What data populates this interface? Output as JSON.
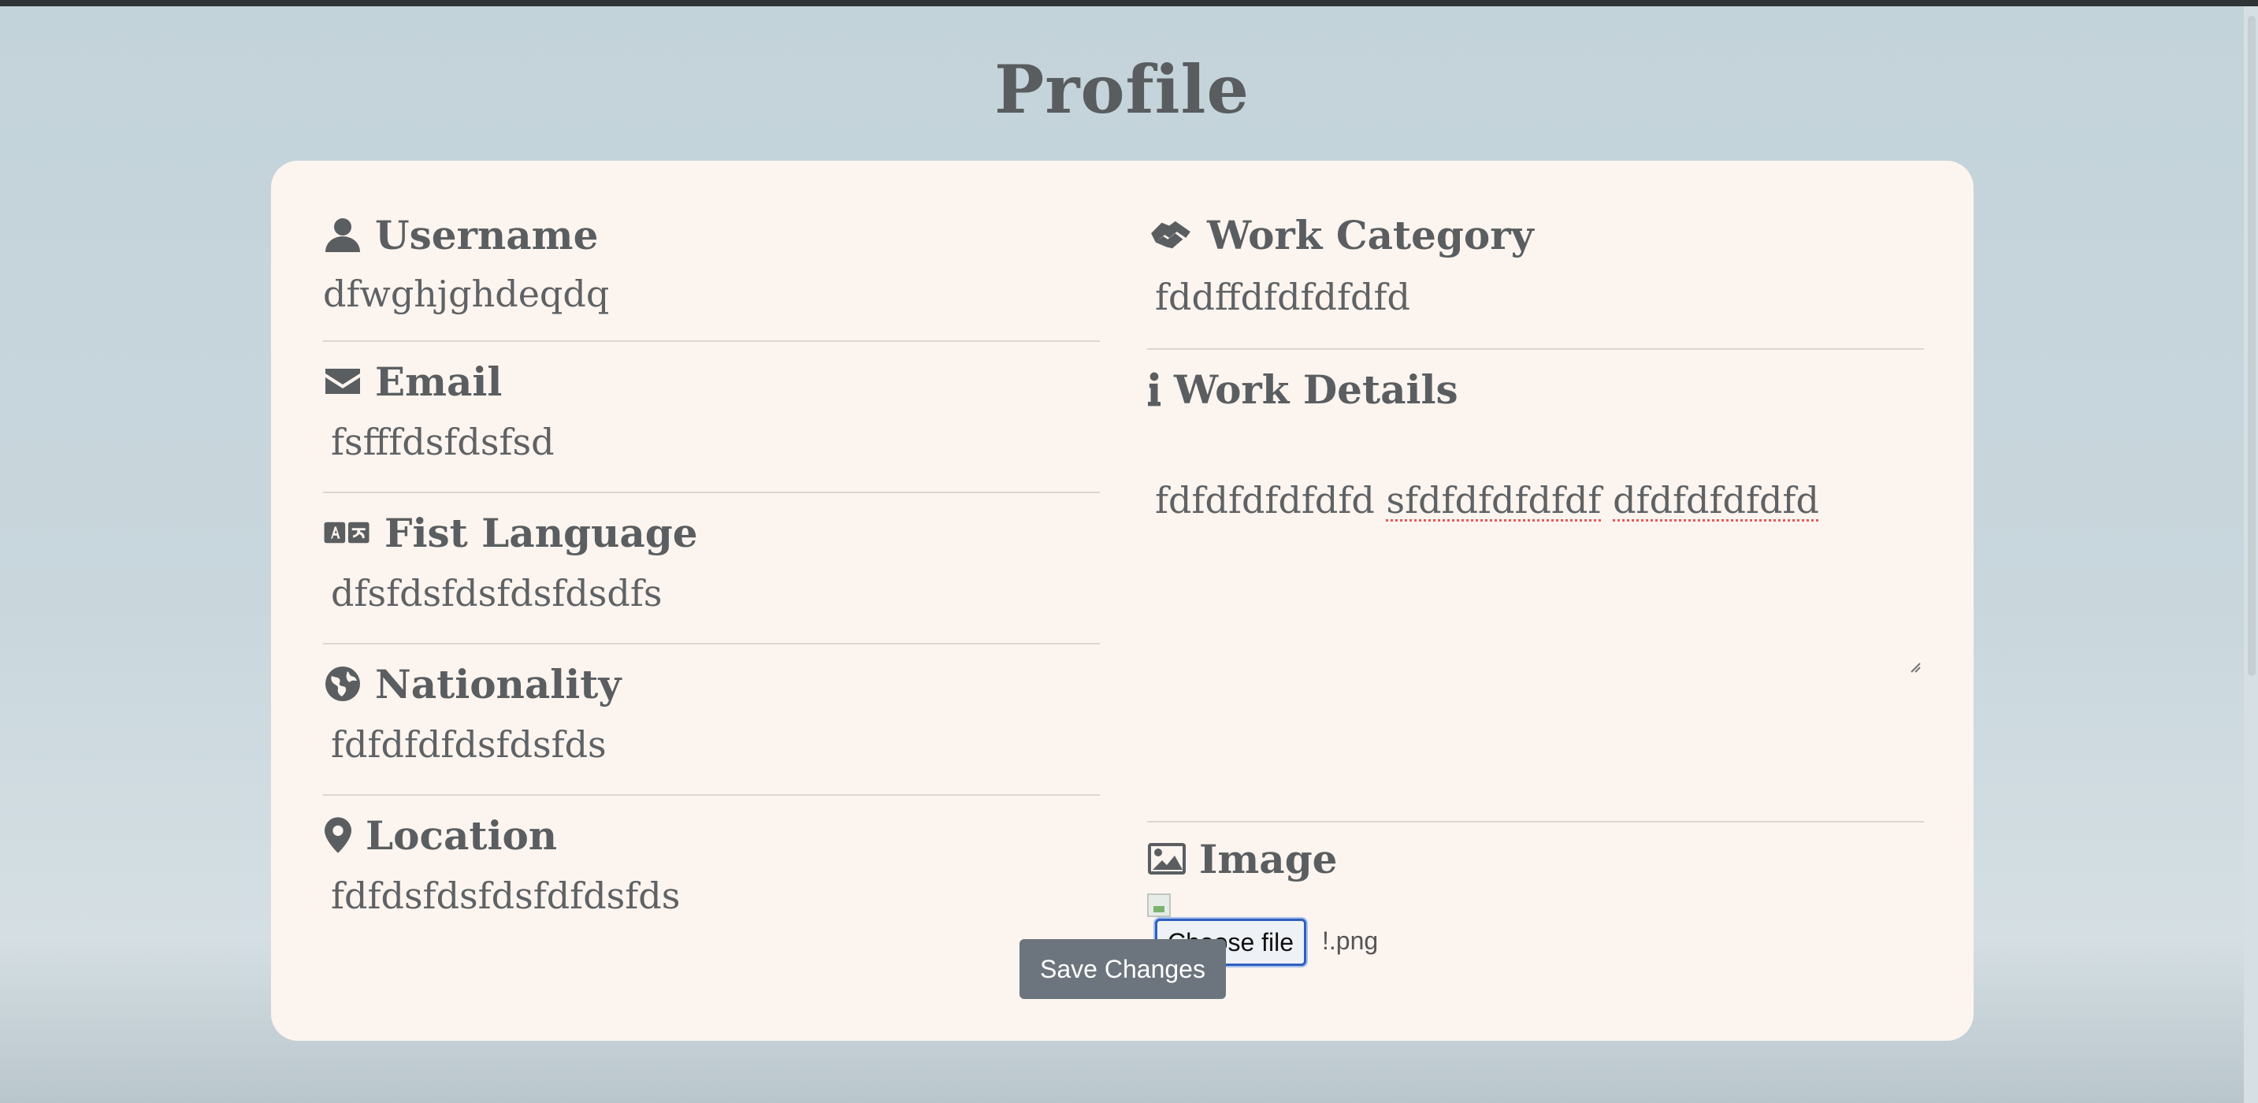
{
  "page": {
    "title": "Profile"
  },
  "left_fields": [
    {
      "label": "Username",
      "value": "dfwghjghdeqdq",
      "icon": "user-icon"
    },
    {
      "label": "Email",
      "value": "fsfffdsfdsfsd",
      "icon": "envelope-icon"
    },
    {
      "label": "Fist Language",
      "value": "dfsfdsfdsfdsfdsdfs",
      "icon": "language-icon"
    },
    {
      "label": "Nationality",
      "value": "fdfdfdfdsfdsfds",
      "icon": "globe-icon"
    },
    {
      "label": "Location",
      "value": "fdfdsfdsfdsfdfdsfds",
      "icon": "map-pin-icon"
    }
  ],
  "work_category": {
    "label": "Work Category",
    "value": "fddffdfdfdfdfd",
    "icon": "handshake-icon"
  },
  "work_details": {
    "label": "Work Details",
    "icon": "info-icon",
    "words": [
      "fdfdfdfdfdfd",
      "sfdfdfdfdfdf",
      "dfdfdfdfdfd"
    ]
  },
  "image": {
    "label": "Image",
    "icon": "image-icon",
    "choose_file_label": "Choose file",
    "file_name": "!.png"
  },
  "actions": {
    "save_label": "Save Changes"
  },
  "colors": {
    "background": "#c3d3da",
    "card": "#fcf4ef",
    "text": "#5a5e60",
    "button": "#6c757d",
    "spellcheck": "#e35a5a"
  }
}
